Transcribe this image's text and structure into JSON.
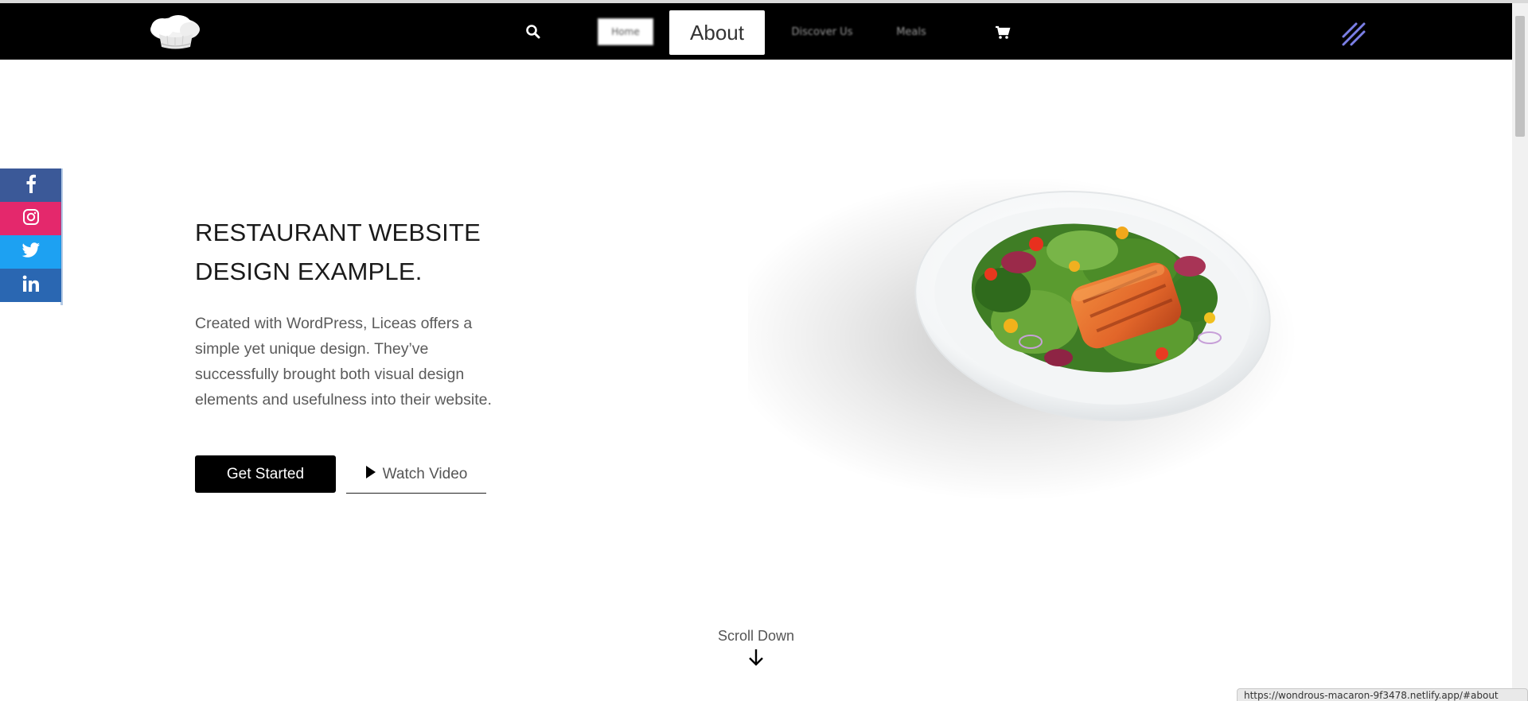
{
  "navbar": {
    "logo_icon": "chef-hat-icon",
    "search_icon": "search-icon",
    "items": [
      {
        "label": "Home"
      },
      {
        "label": "About"
      },
      {
        "label": "Discover Us"
      },
      {
        "label": "Meals"
      }
    ],
    "cart_icon": "cart-icon",
    "menu_icon": "menu-slashes-icon",
    "menu_color": "#7b7fe6"
  },
  "social": [
    {
      "icon": "facebook-icon",
      "color": "#3b5998"
    },
    {
      "icon": "instagram-icon",
      "color": "#e4286c"
    },
    {
      "icon": "twitter-icon",
      "color": "#1da1f2"
    },
    {
      "icon": "linkedin-icon",
      "color": "#2a67b2"
    }
  ],
  "hero": {
    "title_line1": "RESTAURANT WEBSITE",
    "title_line2": "DESIGN EXAMPLE.",
    "description": "Created with WordPress, Liceas offers a simple yet unique design. They’ve successfully brought both visual design elements and usefulness into their website.",
    "primary_button": "Get Started",
    "secondary_button": "Watch Video",
    "image": "salmon-salad-plate"
  },
  "scroll": {
    "label": "Scroll Down"
  },
  "status_bar": {
    "url": "https://wondrous-macaron-9f3478.netlify.app/#about"
  }
}
